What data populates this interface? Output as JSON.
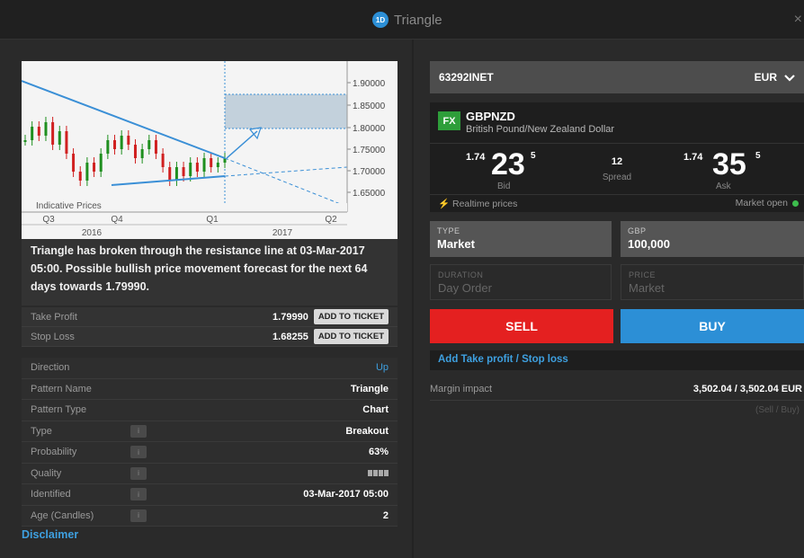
{
  "window": {
    "badge": "1D",
    "title": "Triangle",
    "close": "×"
  },
  "chart_data": {
    "type": "line",
    "title": "",
    "annotation": "Indicative Prices",
    "x_tick_labels_top": [
      "Q3",
      "Q4",
      "Q1",
      "Q2"
    ],
    "x_tick_labels_bottom": [
      "2016",
      "2017"
    ],
    "y_tick_labels": [
      "1.90000",
      "1.85000",
      "1.80000",
      "1.75000",
      "1.70000",
      "1.65000"
    ],
    "ylim": [
      1.63,
      1.93
    ],
    "x": [
      0,
      4,
      8,
      12,
      16,
      20,
      24,
      28,
      32,
      36,
      40,
      44,
      48,
      52,
      56,
      60,
      64,
      68,
      72,
      76,
      80,
      84,
      88,
      92,
      96,
      100,
      104,
      108,
      112,
      116
    ],
    "series": [
      {
        "values": [
          1.79,
          1.82,
          1.8,
          1.83,
          1.78,
          1.81,
          1.76,
          1.72,
          1.7,
          1.74,
          1.72,
          1.76,
          1.79,
          1.77,
          1.8,
          1.78,
          1.75,
          1.77,
          1.79,
          1.76,
          1.73,
          1.7,
          1.73,
          1.71,
          1.74,
          1.72,
          1.75,
          1.73,
          1.74,
          1.75
        ]
      }
    ],
    "colors": {
      "candle_up": "#1f8f1f",
      "candle_down": "#d02020",
      "trendline": "#3a8fd6",
      "forecast_box": "#9ab4c8"
    }
  },
  "pattern": {
    "description": "Triangle has broken through the resistance line at 03-Mar-2017 05:00. Possible bullish price movement forecast for the next 64 days towards 1.79990.",
    "take_profit_label": "Take Profit",
    "take_profit_value": "1.79990",
    "stop_loss_label": "Stop Loss",
    "stop_loss_value": "1.68255",
    "add_button": "ADD TO TICKET"
  },
  "details": [
    {
      "label": "Direction",
      "value": "Up",
      "info": false,
      "style": "up"
    },
    {
      "label": "Pattern Name",
      "value": "Triangle",
      "info": false
    },
    {
      "label": "Pattern Type",
      "value": "Chart",
      "info": false
    },
    {
      "label": "Type",
      "value": "Breakout",
      "info": true
    },
    {
      "label": "Probability",
      "value": "63%",
      "info": true
    },
    {
      "label": "Quality",
      "value": "",
      "info": true,
      "quality_level": 4
    },
    {
      "label": "Identified",
      "value": "03-Mar-2017 05:00",
      "info": true
    },
    {
      "label": "Age (Candles)",
      "value": "2",
      "info": true
    }
  ],
  "disclaimer": "Disclaimer",
  "ticket": {
    "account": "63292INET",
    "currency": "EUR",
    "fx_badge": "FX",
    "instrument_code": "GBPNZD",
    "instrument_name": "British Pound/New Zealand Dollar",
    "bid_small": "1.74",
    "bid_big": "23",
    "bid_sup": "5",
    "bid_label": "Bid",
    "spread_value": "12",
    "spread_label": "Spread",
    "ask_small": "1.74",
    "ask_big": "35",
    "ask_sup": "5",
    "ask_label": "Ask",
    "realtime": "Realtime prices",
    "market_status": "Market open",
    "type_label": "TYPE",
    "type_value": "Market",
    "amount_label": "GBP",
    "amount_value": "100,000",
    "duration_label": "DURATION",
    "duration_value": "Day Order",
    "price_label": "PRICE",
    "price_value": "Market",
    "sell": "SELL",
    "buy": "BUY",
    "add_tp_sl": "Add Take profit / Stop loss",
    "margin_label": "Margin impact",
    "margin_value": "3,502.04 / 3,502.04  EUR",
    "margin_sub": "(Sell / Buy)"
  }
}
